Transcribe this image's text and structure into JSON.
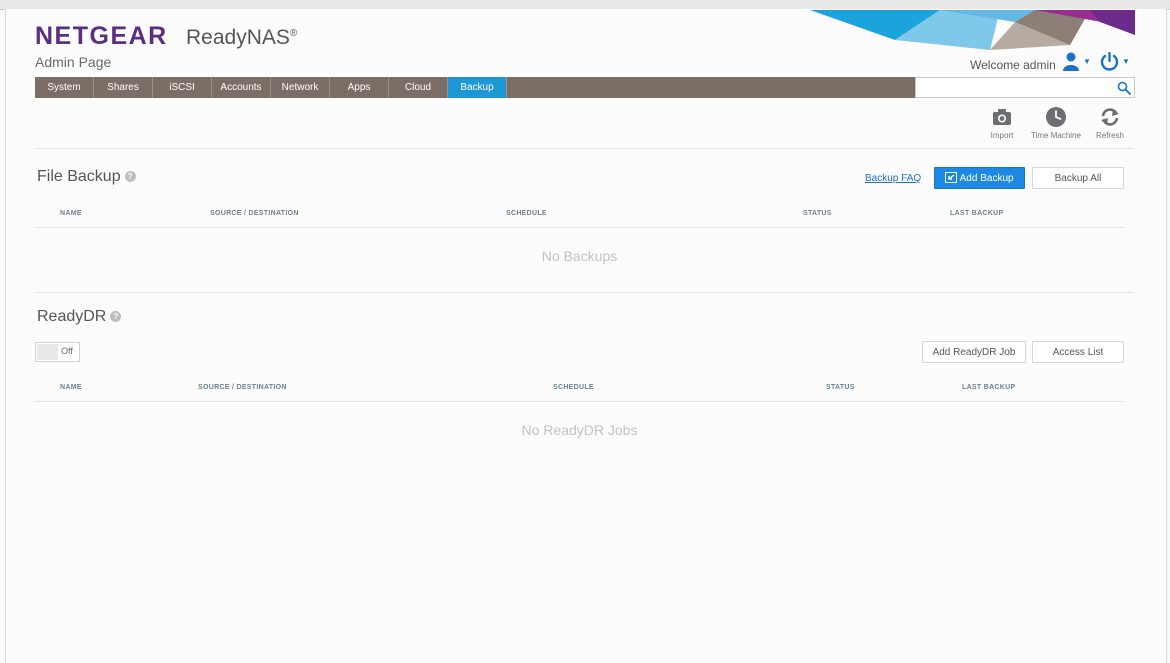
{
  "header": {
    "logo": "NETGEAR",
    "product": "ReadyNAS",
    "product_mark": "®",
    "admin_title": "Admin Page",
    "welcome": "Welcome admin"
  },
  "nav": {
    "tabs": [
      "System",
      "Shares",
      "iSCSI",
      "Accounts",
      "Network",
      "Apps",
      "Cloud",
      "Backup"
    ],
    "active": "Backup"
  },
  "search": {
    "value": "",
    "placeholder": ""
  },
  "toolbar": {
    "import_label": "Import",
    "time_machine_label": "Time Machine",
    "refresh_label": "Refresh"
  },
  "file_backup": {
    "title": "File Backup",
    "help": "?",
    "faq_link": "Backup FAQ",
    "add_button": "Add Backup",
    "backup_all_button": "Backup All",
    "columns": [
      "NAME",
      "SOURCE / DESTINATION",
      "SCHEDULE",
      "STATUS",
      "LAST BACKUP"
    ],
    "empty_message": "No Backups"
  },
  "ready_dr": {
    "title": "ReadyDR",
    "help": "?",
    "toggle_label": "Off",
    "add_job_button": "Add ReadyDR Job",
    "access_list_button": "Access List",
    "columns": [
      "NAME",
      "SOURCE / DESTINATION",
      "SCHEDULE",
      "STATUS",
      "LAST BACKUP"
    ],
    "empty_message": "No ReadyDR Jobs"
  },
  "colors": {
    "brand": "#5b2e83",
    "accent": "#1f97d4",
    "nav_bg": "#7a6e66",
    "primary_button": "#1e88e5"
  },
  "icons": {
    "search": "search-icon",
    "import": "camera-icon",
    "time_machine": "clock-icon",
    "refresh": "refresh-icon",
    "user": "user-icon",
    "power": "power-icon",
    "help": "help-icon",
    "add": "add-backup-icon"
  }
}
